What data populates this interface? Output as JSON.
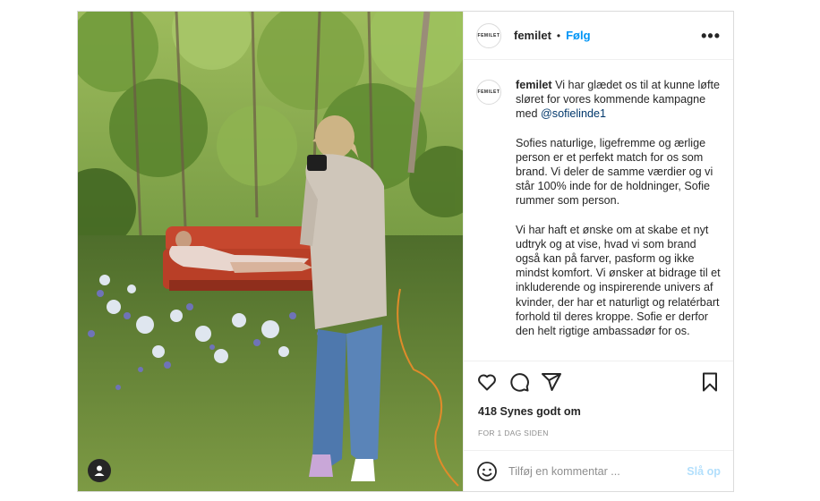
{
  "post": {
    "account": {
      "username": "femilet",
      "avatar_text": "FEMILET",
      "separator": "•",
      "follow_label": "Følg",
      "more_label": "•••"
    },
    "caption": {
      "username": "femilet",
      "paragraph_1_text": " Vi har glædet os til at kunne løfte sløret for vores kommende kampagne med ",
      "mention": "@sofielinde1",
      "paragraph_2": "Sofies naturlige, ligefremme og ærlige person er et perfekt match for os som brand. Vi deler de samme værdier og vi står 100% inde for de holdninger, Sofie rummer som person.",
      "paragraph_3": "Vi har haft et ønske om at skabe et nyt udtryk og at vise, hvad vi som brand også kan på farver, pasform og ikke mindst komfort. Vi ønsker at bidrage til et inkluderende og inspirerende univers af kvinder, der har et naturligt og relatérbart forhold til deres kroppe. Sofie er derfor den helt rigtige ambassadør for os."
    },
    "actions": {
      "like_icon": "heart-icon",
      "comment_icon": "comment-icon",
      "share_icon": "share-icon",
      "save_icon": "bookmark-icon"
    },
    "likes_text": "418 Synes godt om",
    "timestamp": "FOR 1 DAG SIDEN",
    "comment_box": {
      "placeholder": "Tilføj en kommentar ...",
      "post_label": "Slå op",
      "emoji_icon": "smiley-icon"
    },
    "photo": {
      "user_tag_icon": "user-tag-icon"
    }
  }
}
